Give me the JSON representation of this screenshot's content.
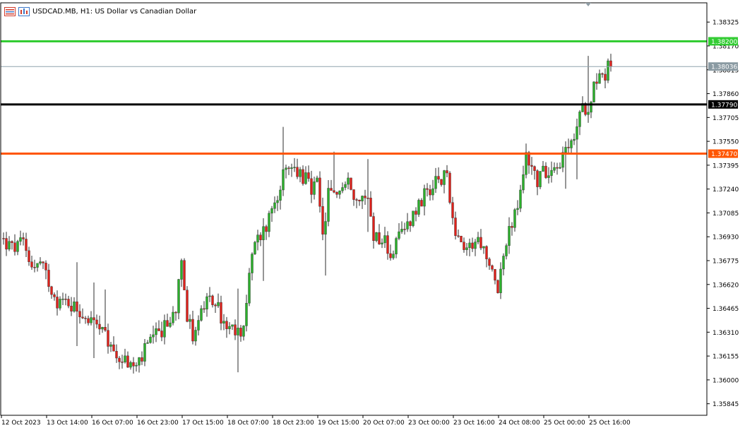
{
  "window": {
    "title": "USDCAD.MB, H1:  US Dollar vs Canadian Dollar",
    "symbol": "USDCAD.MB",
    "timeframe": "H1",
    "description": "US Dollar vs Canadian Dollar"
  },
  "icons": [
    "window-list-icon",
    "chart-type-icon"
  ],
  "colors": {
    "bull": "#2bb02b",
    "bear": "#e0201a",
    "wick": "#2d2d2d",
    "level_green": "#33cc33",
    "level_black": "#000000",
    "level_orange": "#ff5500",
    "bid_line": "#8fa3ad",
    "label_black_bg": "#000000",
    "label_orange_bg": "#ff5500",
    "label_green_bg": "#33cc33",
    "label_bid_bg": "#8a9aa2"
  },
  "chart_data": {
    "type": "candlestick",
    "ylim": [
      1.3577,
      1.3845
    ],
    "y_ticks": [
      {
        "value": 1.38325,
        "label": "1.38325"
      },
      {
        "value": 1.3817,
        "label": "1.38170"
      },
      {
        "value": 1.38015,
        "label": "1.38015"
      },
      {
        "value": 1.3786,
        "label": "1.37860"
      },
      {
        "value": 1.37705,
        "label": "1.37705"
      },
      {
        "value": 1.3755,
        "label": "1.37550"
      },
      {
        "value": 1.37395,
        "label": "1.37395"
      },
      {
        "value": 1.3724,
        "label": "1.37240"
      },
      {
        "value": 1.37085,
        "label": "1.37085"
      },
      {
        "value": 1.3693,
        "label": "1.36930"
      },
      {
        "value": 1.36775,
        "label": "1.36775"
      },
      {
        "value": 1.3662,
        "label": "1.36620"
      },
      {
        "value": 1.36465,
        "label": "1.36465"
      },
      {
        "value": 1.3631,
        "label": "1.36310"
      },
      {
        "value": 1.36155,
        "label": "1.36155"
      },
      {
        "value": 1.36,
        "label": "1.36000"
      },
      {
        "value": 1.35845,
        "label": "1.35845"
      }
    ],
    "x_ticks": [
      {
        "index": 0,
        "label": "12 Oct 2023"
      },
      {
        "index": 16,
        "label": "13 Oct 14:00"
      },
      {
        "index": 32,
        "label": "16 Oct 07:00"
      },
      {
        "index": 48,
        "label": "16 Oct 23:00"
      },
      {
        "index": 64,
        "label": "17 Oct 15:00"
      },
      {
        "index": 80,
        "label": "18 Oct 07:00"
      },
      {
        "index": 96,
        "label": "18 Oct 23:00"
      },
      {
        "index": 112,
        "label": "19 Oct 15:00"
      },
      {
        "index": 128,
        "label": "20 Oct 07:00"
      },
      {
        "index": 144,
        "label": "23 Oct 00:00"
      },
      {
        "index": 160,
        "label": "23 Oct 16:00"
      },
      {
        "index": 176,
        "label": "24 Oct 08:00"
      },
      {
        "index": 192,
        "label": "25 Oct 00:00"
      },
      {
        "index": 208,
        "label": "25 Oct 16:00"
      }
    ],
    "levels": [
      {
        "name": "level-green",
        "value": 1.382,
        "label": "1.38200",
        "color": "#33cc33",
        "width": 3
      },
      {
        "name": "bid-line",
        "value": 1.38036,
        "label": "1.38036",
        "color": "#8fa3ad",
        "width": 1
      },
      {
        "name": "level-black",
        "value": 1.3779,
        "label": "1.37790",
        "color": "#000000",
        "width": 3
      },
      {
        "name": "level-orange",
        "value": 1.3747,
        "label": "1.37470",
        "color": "#ff5500",
        "width": 3
      }
    ],
    "anchors": [
      [
        0,
        1.3692
      ],
      [
        4,
        1.3685
      ],
      [
        8,
        1.3688
      ],
      [
        10,
        1.3678
      ],
      [
        12,
        1.3674
      ],
      [
        14,
        1.3675
      ],
      [
        16,
        1.3668
      ],
      [
        18,
        1.366
      ],
      [
        20,
        1.3652
      ],
      [
        24,
        1.365
      ],
      [
        28,
        1.3645
      ],
      [
        32,
        1.3638
      ],
      [
        36,
        1.363
      ],
      [
        40,
        1.3618
      ],
      [
        44,
        1.3612
      ],
      [
        48,
        1.3608
      ],
      [
        52,
        1.3622
      ],
      [
        56,
        1.363
      ],
      [
        60,
        1.3638
      ],
      [
        62,
        1.3648
      ],
      [
        64,
        1.3683
      ],
      [
        66,
        1.364
      ],
      [
        68,
        1.363
      ],
      [
        72,
        1.3648
      ],
      [
        76,
        1.3652
      ],
      [
        78,
        1.364
      ],
      [
        80,
        1.3632
      ],
      [
        84,
        1.363
      ],
      [
        86,
        1.3636
      ],
      [
        88,
        1.3668
      ],
      [
        90,
        1.3688
      ],
      [
        94,
        1.37
      ],
      [
        96,
        1.3712
      ],
      [
        100,
        1.3732
      ],
      [
        104,
        1.3738
      ],
      [
        108,
        1.373
      ],
      [
        110,
        1.3722
      ],
      [
        112,
        1.3727
      ],
      [
        114,
        1.3692
      ],
      [
        116,
        1.372
      ],
      [
        120,
        1.3724
      ],
      [
        124,
        1.3728
      ],
      [
        126,
        1.3716
      ],
      [
        130,
        1.3718
      ],
      [
        132,
        1.3695
      ],
      [
        136,
        1.369
      ],
      [
        138,
        1.3682
      ],
      [
        140,
        1.3688
      ],
      [
        144,
        1.3702
      ],
      [
        148,
        1.3715
      ],
      [
        150,
        1.372
      ],
      [
        152,
        1.3717
      ],
      [
        154,
        1.373
      ],
      [
        156,
        1.3728
      ],
      [
        158,
        1.3734
      ],
      [
        160,
        1.3705
      ],
      [
        162,
        1.3692
      ],
      [
        164,
        1.368
      ],
      [
        166,
        1.3688
      ],
      [
        170,
        1.369
      ],
      [
        172,
        1.3674
      ],
      [
        174,
        1.367
      ],
      [
        176,
        1.3662
      ],
      [
        178,
        1.368
      ],
      [
        180,
        1.3695
      ],
      [
        184,
        1.372
      ],
      [
        186,
        1.3748
      ],
      [
        188,
        1.3738
      ],
      [
        190,
        1.373
      ],
      [
        194,
        1.3738
      ],
      [
        198,
        1.3742
      ],
      [
        202,
        1.3752
      ],
      [
        204,
        1.3765
      ],
      [
        206,
        1.3776
      ],
      [
        208,
        1.3779
      ],
      [
        210,
        1.3792
      ],
      [
        212,
        1.38
      ],
      [
        214,
        1.3798
      ],
      [
        215,
        1.38036
      ]
    ]
  }
}
